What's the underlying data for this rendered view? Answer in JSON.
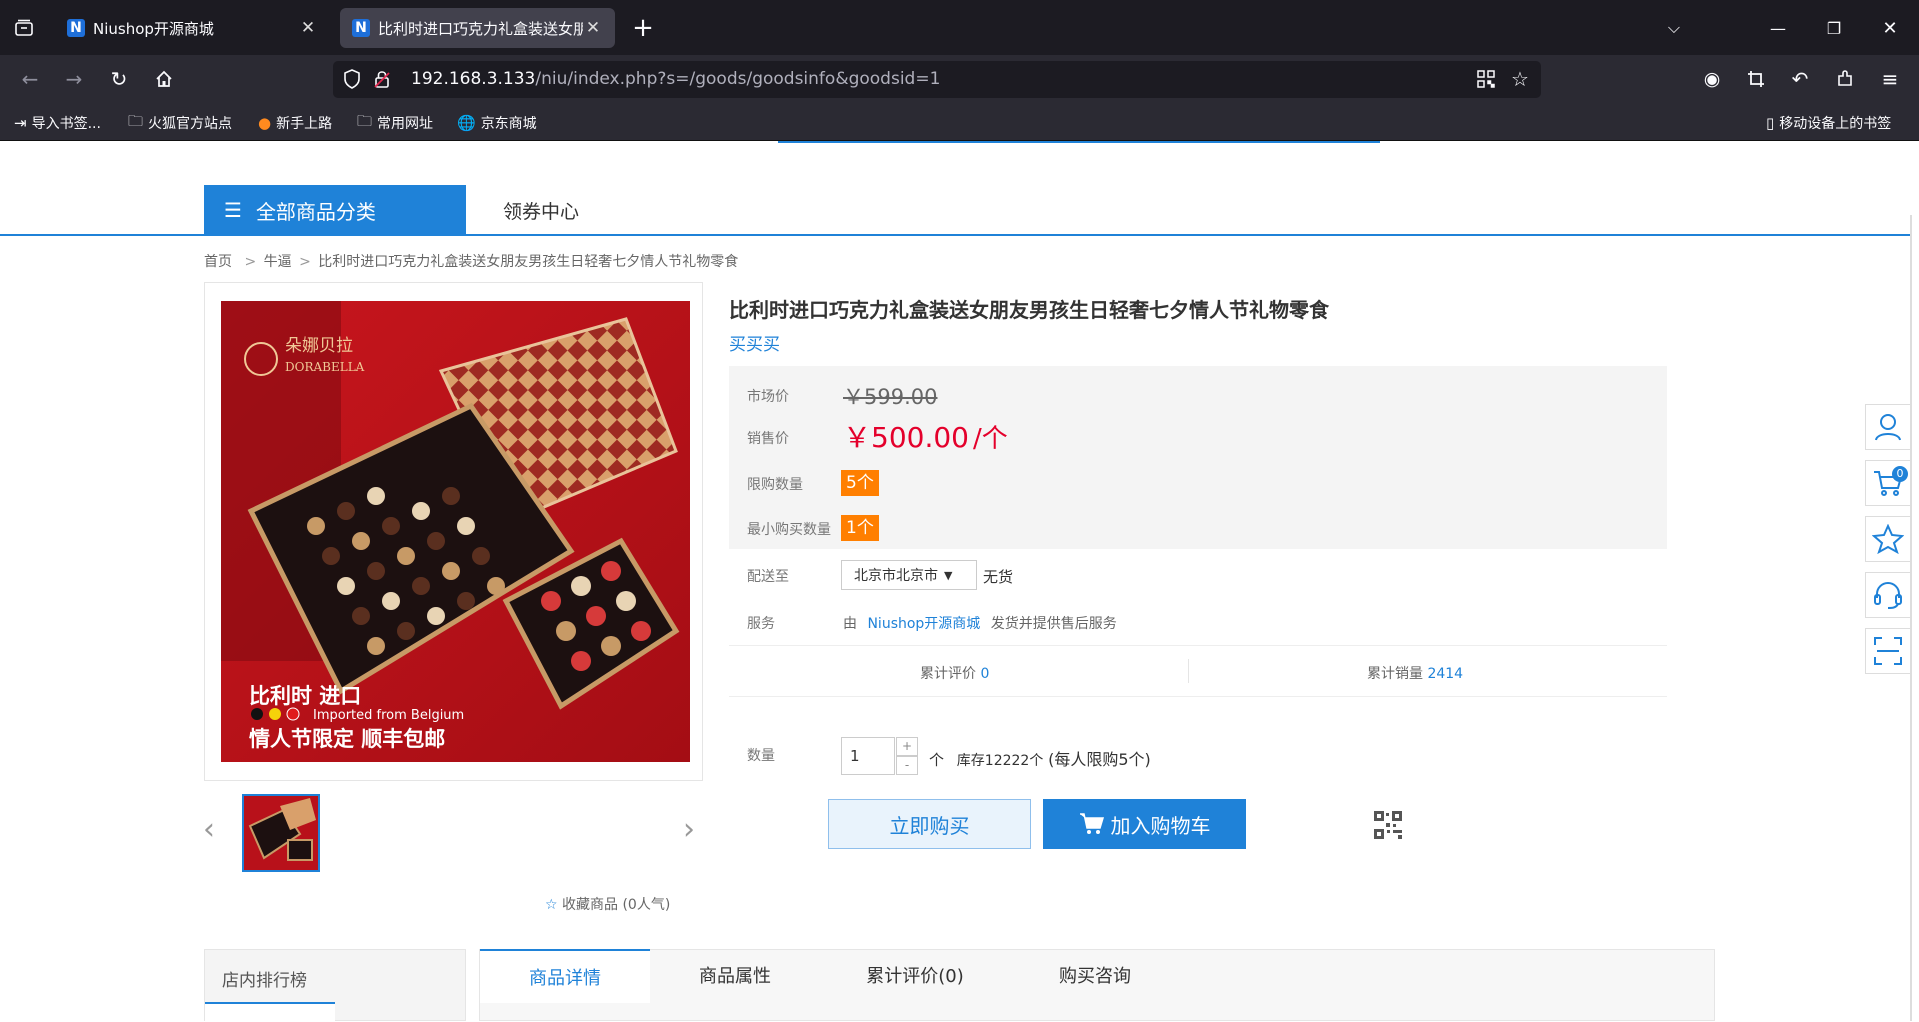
{
  "browser": {
    "tabs": [
      {
        "favicon": "N",
        "title": "Niushop开源商城"
      },
      {
        "favicon": "N",
        "title": "比利时进口巧克力礼盒装送女朋"
      }
    ],
    "url_host": "192.168.3.133",
    "url_path": "/niu/index.php?s=/goods/goodsinfo&goodsid=1",
    "bookmarks": [
      "导入书签...",
      "火狐官方站点",
      "新手上路",
      "常用网址",
      "京东商城"
    ],
    "mobile_bookmarks": "移动设备上的书签"
  },
  "nav": {
    "all_categories": "全部商品分类",
    "coupon_center": "领券中心"
  },
  "breadcrumb": {
    "home": "首页",
    "sep": ">",
    "category": "牛逼",
    "current": "比利时进口巧克力礼盒装送女朋友男孩生日轻奢七夕情人节礼物零食"
  },
  "image_text": {
    "brand_cn": "朵娜贝拉",
    "brand_en": "DORABELLA",
    "line1": "比利时 进口",
    "line2": "Imported from Belgium",
    "line3": "情人节限定 顺丰包邮"
  },
  "product": {
    "title": "比利时进口巧克力礼盒装送女朋友男孩生日轻奢七夕情人节礼物零食",
    "subtitle": "买买买",
    "market_price_label": "市场价",
    "market_price": "￥599.00",
    "sale_price_label": "销售价",
    "sale_price": "￥500.00",
    "sale_unit": "/个",
    "limit_label": "限购数量",
    "limit_value": "5个",
    "min_label": "最小购买数量",
    "min_value": "1个",
    "ship_label": "配送至",
    "region": "北京市北京市",
    "stock_status": "无货",
    "service_label": "服务",
    "service_prefix": "由",
    "service_store": "Niushop开源商城",
    "service_suffix": "发货并提供售后服务",
    "reviews_label": "累计评价",
    "reviews_count": "0",
    "sales_label": "累计销量",
    "sales_count": "2414",
    "qty_label": "数量",
    "qty_value": "1",
    "qty_plus": "+",
    "qty_minus": "-",
    "qty_unit": "个",
    "stock_text": "库存12222个",
    "limit_note": "(每人限购5个)",
    "buy_now": "立即购买",
    "add_cart": "加入购物车",
    "favorite": "收藏商品 (0人气)"
  },
  "sidebar": {
    "cart_count": "0",
    "icons": [
      "user-icon",
      "cart-icon",
      "star-icon",
      "headset-icon",
      "scan-icon"
    ]
  },
  "bottom": {
    "rank_title": "店内排行榜",
    "tabs": [
      "商品详情",
      "商品属性",
      "累计评价(0)",
      "购买咨询"
    ]
  },
  "colors": {
    "accent": "#1f82d8",
    "price_red": "#e4002b",
    "badge_orange": "#ff7f00"
  }
}
